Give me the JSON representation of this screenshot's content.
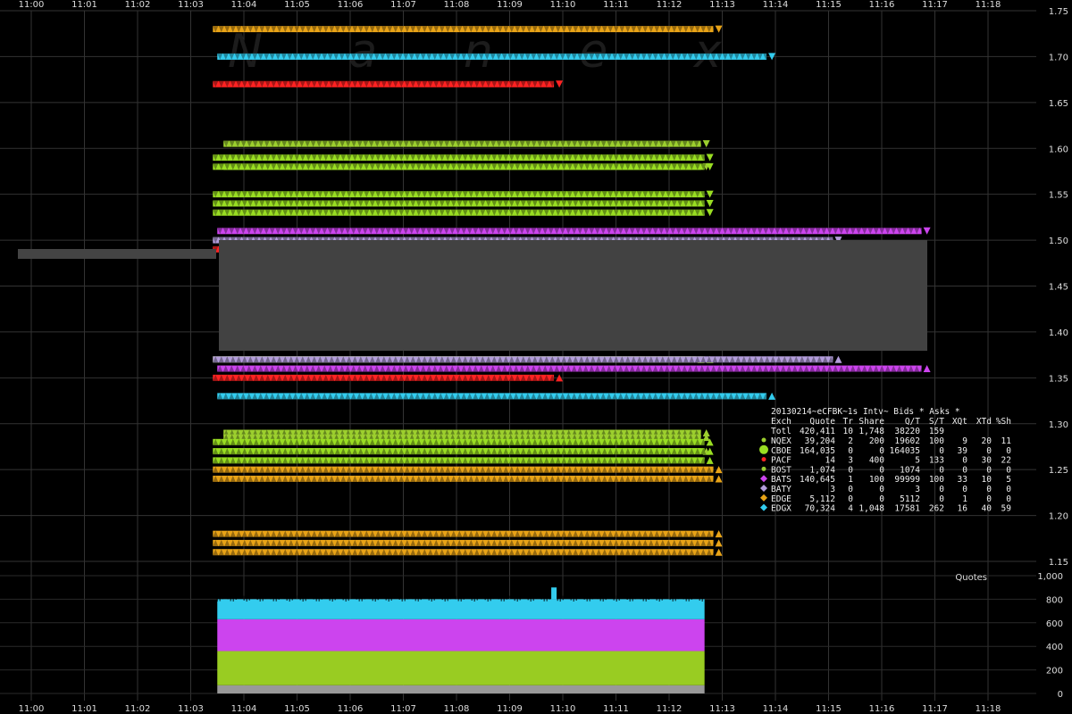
{
  "chart_data": {
    "type": "scatter",
    "title": "20130214~eCFBK~1s Intv~ Bids * Asks *",
    "x_ticks": [
      "11:00",
      "11:01",
      "11:02",
      "11:03",
      "11:04",
      "11:05",
      "11:06",
      "11:07",
      "11:08",
      "11:09",
      "11:10",
      "11:11",
      "11:12",
      "11:13",
      "11:14",
      "11:15",
      "11:16",
      "11:17",
      "11:18"
    ],
    "y_ticks": [
      "1.15",
      "1.20",
      "1.25",
      "1.30",
      "1.35",
      "1.40",
      "1.45",
      "1.50",
      "1.55",
      "1.60",
      "1.65",
      "1.70",
      "1.75"
    ],
    "ylim": [
      1.15,
      1.75
    ],
    "watermark": "N a n e x",
    "series": [
      {
        "name": "NQEX",
        "color": "#9ccf2e",
        "shape": "dot",
        "price_levels": [
          1.605,
          1.58,
          1.29,
          1.285,
          1.27
        ],
        "side": [
          "ask",
          "ask",
          "bid",
          "bid",
          "bid"
        ],
        "time_range": [
          "11:03:37",
          "11:12:36"
        ]
      },
      {
        "name": "CBOE",
        "color": "#99dd22",
        "shape": "circle",
        "price_levels": [
          1.59,
          1.58,
          1.55,
          1.54,
          1.53,
          1.37,
          1.28,
          1.27,
          1.26
        ],
        "side": [
          "ask",
          "ask",
          "ask",
          "ask",
          "ask",
          "bid",
          "bid",
          "bid",
          "bid"
        ],
        "time_range": [
          "11:03:25",
          "11:12:40"
        ]
      },
      {
        "name": "PACF",
        "color": "#ff2222",
        "shape": "dot",
        "price_levels": [
          1.67,
          1.49,
          1.35
        ],
        "side": [
          "ask",
          "ask",
          "bid"
        ],
        "time_range": [
          "11:03:25",
          "11:09:50"
        ]
      },
      {
        "name": "BOST",
        "color": "#99cc33",
        "shape": "dot",
        "price_levels": [
          1.37
        ],
        "side": [
          "bid"
        ],
        "time_range": [
          "11:03:40",
          "11:12:30"
        ]
      },
      {
        "name": "BATS",
        "color": "#cc44ee",
        "shape": "diamond",
        "price_levels": [
          1.51,
          1.36
        ],
        "side": [
          "ask",
          "bid"
        ],
        "time_range": [
          "11:03:30",
          "11:16:45"
        ]
      },
      {
        "name": "BATY",
        "color": "#b39ddb",
        "shape": "diamond",
        "price_levels": [
          1.5,
          1.37
        ],
        "side": [
          "ask",
          "bid"
        ],
        "time_range": [
          "11:03:25",
          "11:15:05"
        ]
      },
      {
        "name": "EDGE",
        "color": "#e8a317",
        "shape": "diamond",
        "price_levels": [
          1.73,
          1.25,
          1.24,
          1.18,
          1.17,
          1.16
        ],
        "side": [
          "ask",
          "bid",
          "bid",
          "bid",
          "bid",
          "bid"
        ],
        "time_range": [
          "11:03:25",
          "11:12:50"
        ]
      },
      {
        "name": "EDGX",
        "color": "#33ccee",
        "shape": "diamond",
        "price_levels": [
          1.7,
          1.33
        ],
        "side": [
          "ask",
          "bid"
        ],
        "time_range": [
          "11:03:30",
          "11:13:50"
        ]
      }
    ],
    "volume_panel": {
      "label": "Quotes",
      "y_ticks": [
        "0",
        "200",
        "400",
        "600",
        "800",
        "1,000"
      ],
      "ylim": [
        0,
        1000
      ],
      "stack_colors": [
        "#999999",
        "#99cc22",
        "#cc44ee",
        "#33ccee"
      ],
      "time_range": [
        "11:03:30",
        "11:12:40"
      ],
      "typical_stack": [
        70,
        290,
        270,
        170
      ],
      "spike": {
        "time": "11:09:50",
        "total": 900
      }
    },
    "stats_table": {
      "columns": [
        "Exch",
        "Quote",
        "Tr",
        "Share",
        "Q/T",
        "S/T",
        "XQt",
        "XTd",
        "%Sh"
      ],
      "total_row": [
        "Totl",
        "420,411",
        "10",
        "1,748",
        "38220",
        "159",
        "",
        "",
        ""
      ],
      "rows": [
        [
          "NQEX",
          "39,204",
          "2",
          "200",
          "19602",
          "100",
          "9",
          "20",
          "11"
        ],
        [
          "CBOE",
          "164,035",
          "0",
          "0",
          "164035",
          "0",
          "39",
          "0",
          "0"
        ],
        [
          "PACF",
          "14",
          "3",
          "400",
          "5",
          "133",
          "0",
          "30",
          "22"
        ],
        [
          "BOST",
          "1,074",
          "0",
          "0",
          "1074",
          "0",
          "0",
          "0",
          "0"
        ],
        [
          "BATS",
          "140,645",
          "1",
          "100",
          "99999",
          "100",
          "33",
          "10",
          "5"
        ],
        [
          "BATY",
          "3",
          "0",
          "0",
          "3",
          "0",
          "0",
          "0",
          "0"
        ],
        [
          "EDGE",
          "5,112",
          "0",
          "0",
          "5112",
          "0",
          "1",
          "0",
          "0"
        ],
        [
          "EDGX",
          "70,324",
          "4",
          "1,048",
          "17581",
          "262",
          "16",
          "40",
          "59"
        ]
      ]
    }
  }
}
